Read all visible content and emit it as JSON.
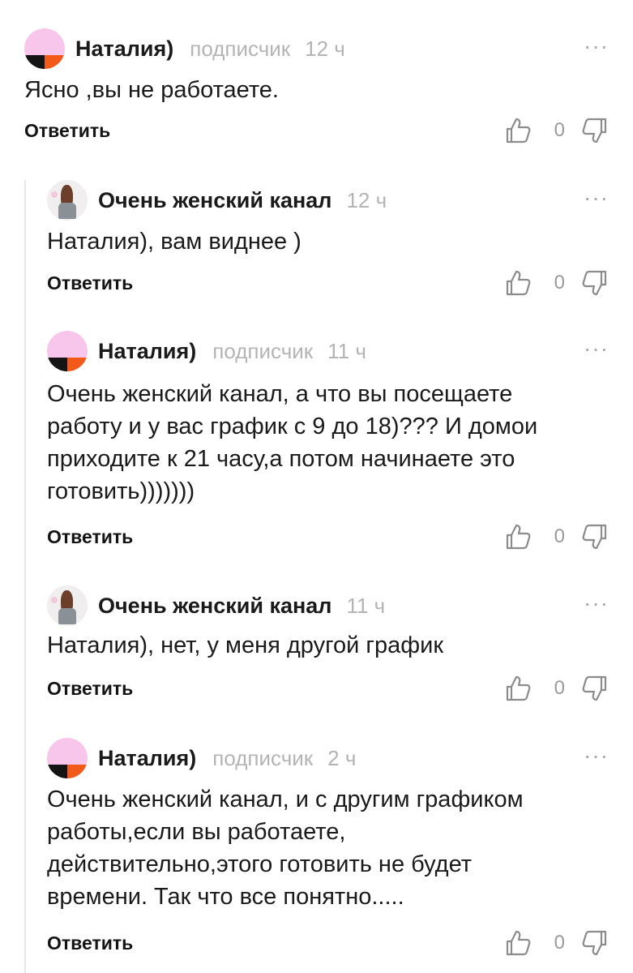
{
  "reply_label": "Ответить",
  "more_label": "···",
  "comments": [
    {
      "author": "Наталия)",
      "badge": "подписчик",
      "time": "12 ч",
      "lines": [
        "Ясно ,вы не работаете."
      ],
      "likes": "0"
    },
    {
      "author": "Очень женский канал",
      "time": "12 ч",
      "lines": [
        "Наталия), вам виднее  )"
      ],
      "likes": "0"
    },
    {
      "author": "Наталия)",
      "badge": "подписчик",
      "time": "11 ч",
      "lines": [
        "Очень женский канал, а что вы посещаете",
        "работу и у вас график с 9 до 18)??? И домои",
        "приходите к 21 часу,а потом начинаете это",
        "готовить)))))))"
      ],
      "likes": "0"
    },
    {
      "author": "Очень женский канал",
      "time": "11 ч",
      "lines": [
        "Наталия), нет, у меня другой график"
      ],
      "likes": "0"
    },
    {
      "author": "Наталия)",
      "badge": "подписчик",
      "time": "2 ч",
      "lines": [
        "Очень женский канал, и с другим графиком",
        "работы,если вы работаете,",
        "действительно,этого готовить не будет",
        "времени. Так что все понятно....."
      ],
      "likes": "0"
    }
  ]
}
